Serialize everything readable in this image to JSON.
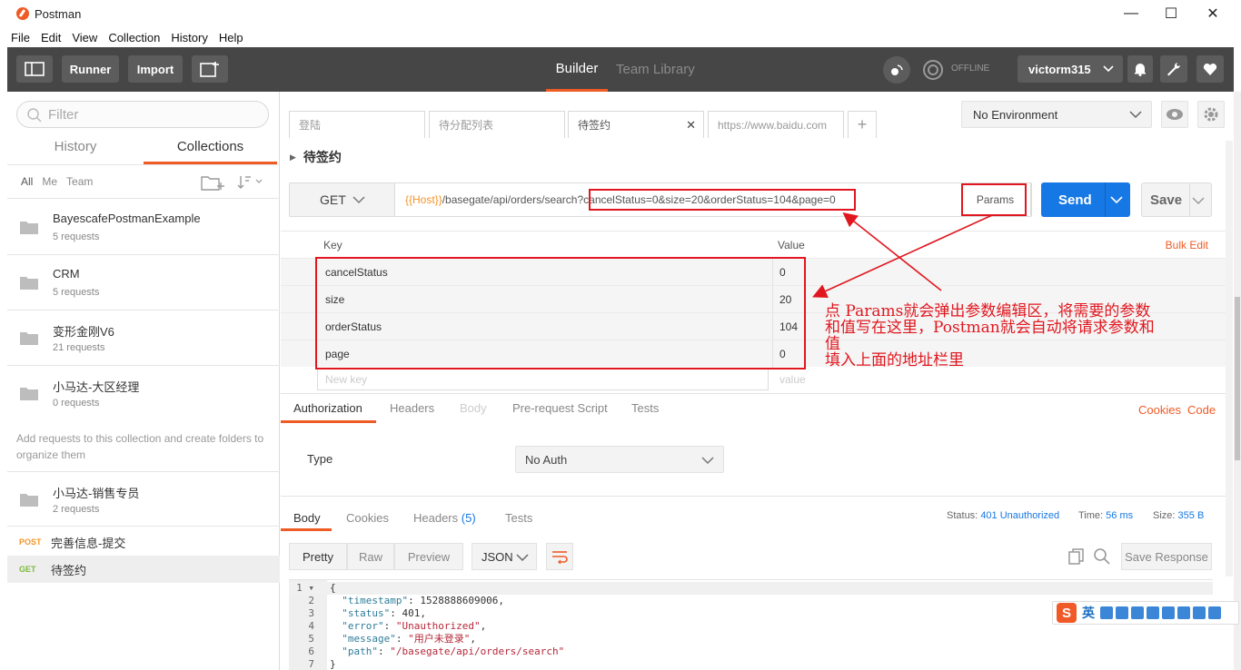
{
  "window": {
    "title": "Postman",
    "minimize": "—",
    "maximize": "☐",
    "close": "✕"
  },
  "menu": [
    "File",
    "Edit",
    "View",
    "Collection",
    "History",
    "Help"
  ],
  "header": {
    "runner": "Runner",
    "import": "Import",
    "builder": "Builder",
    "team_library": "Team Library",
    "offline": "OFFLINE",
    "user": "victorm315"
  },
  "sidebar": {
    "filter_placeholder": "Filter",
    "tab_history": "History",
    "tab_collections": "Collections",
    "filter_all": "All",
    "filter_me": "Me",
    "filter_team": "Team",
    "collections": [
      {
        "name": "BayescafePostmanExample",
        "count": "5 requests"
      },
      {
        "name": "CRM",
        "count": "5 requests"
      },
      {
        "name": "变形金刚V6",
        "count": "21 requests"
      },
      {
        "name": "小马达-大区经理",
        "count": "0 requests"
      },
      {
        "name": "小马达-销售专员",
        "count": "2 requests"
      }
    ],
    "hint": "Add requests to this collection and create folders to organize them",
    "requests": [
      {
        "method": "POST",
        "name": "完善信息-提交",
        "color": "#f49427"
      },
      {
        "method": "GET",
        "name": "待签约",
        "color": "#7bba3c"
      }
    ]
  },
  "tabs": [
    "登陆",
    "待分配列表",
    "待签约",
    "https://www.baidu.com"
  ],
  "environment": "No Environment",
  "request": {
    "title": "待签约",
    "method": "GET",
    "url_var": "{{Host}}",
    "url_path": "/basegate/api/orders/search",
    "url_query": "?cancelStatus=0&size=20&orderStatus=104&page=0",
    "params": "Params",
    "send": "Send",
    "save": "Save"
  },
  "params_table": {
    "key_header": "Key",
    "value_header": "Value",
    "bulk_edit": "Bulk Edit",
    "rows": [
      {
        "key": "cancelStatus",
        "value": "0"
      },
      {
        "key": "size",
        "value": "20"
      },
      {
        "key": "orderStatus",
        "value": "104"
      },
      {
        "key": "page",
        "value": "0"
      }
    ],
    "new_key": "New key",
    "new_value": "value"
  },
  "request_tabs": {
    "authorization": "Authorization",
    "headers": "Headers",
    "body": "Body",
    "prerequest": "Pre-request Script",
    "tests": "Tests",
    "cookies": "Cookies",
    "code": "Code"
  },
  "auth": {
    "type_label": "Type",
    "type_value": "No Auth"
  },
  "response": {
    "tab_body": "Body",
    "tab_cookies": "Cookies",
    "tab_headers": "Headers",
    "headers_count": "(5)",
    "tab_tests": "Tests",
    "status_label": "Status:",
    "status_value": "401 Unauthorized",
    "time_label": "Time:",
    "time_value": "56 ms",
    "size_label": "Size:",
    "size_value": "355 B",
    "pretty": "Pretty",
    "raw": "Raw",
    "preview": "Preview",
    "format": "JSON",
    "save_response": "Save Response"
  },
  "code_lines": [
    {
      "n": "1 ▾",
      "parts": [
        {
          "t": "{",
          "c": "jn"
        }
      ]
    },
    {
      "n": "2",
      "parts": [
        {
          "t": "  \"timestamp\"",
          "c": "jk"
        },
        {
          "t": ": 1528888609006,",
          "c": "jn"
        }
      ]
    },
    {
      "n": "3",
      "parts": [
        {
          "t": "  \"status\"",
          "c": "jk"
        },
        {
          "t": ": 401,",
          "c": "jn"
        }
      ]
    },
    {
      "n": "4",
      "parts": [
        {
          "t": "  \"error\"",
          "c": "jk"
        },
        {
          "t": ": ",
          "c": "jn"
        },
        {
          "t": "\"Unauthorized\"",
          "c": "js"
        },
        {
          "t": ",",
          "c": "jn"
        }
      ]
    },
    {
      "n": "5",
      "parts": [
        {
          "t": "  \"message\"",
          "c": "jk"
        },
        {
          "t": ": ",
          "c": "jn"
        },
        {
          "t": "\"用户未登录\"",
          "c": "js"
        },
        {
          "t": ",",
          "c": "jn"
        }
      ]
    },
    {
      "n": "6",
      "parts": [
        {
          "t": "  \"path\"",
          "c": "jk"
        },
        {
          "t": ": ",
          "c": "jn"
        },
        {
          "t": "\"/basegate/api/orders/search\"",
          "c": "js"
        }
      ]
    },
    {
      "n": "7",
      "parts": [
        {
          "t": "}",
          "c": "jn"
        }
      ]
    }
  ],
  "annotation": {
    "line1": "点 Params就会弹出参数编辑区，将需要的参数",
    "line2": "和值写在这里，Postman就会自动将请求参数和",
    "line3": "值",
    "line4": "填入上面的地址栏里",
    "color": "#e0171f"
  },
  "ime": {
    "logo": "S",
    "lang": "英"
  },
  "colors": {
    "accent": "#ef5b25",
    "send": "#1678e4",
    "header": "#464646"
  }
}
